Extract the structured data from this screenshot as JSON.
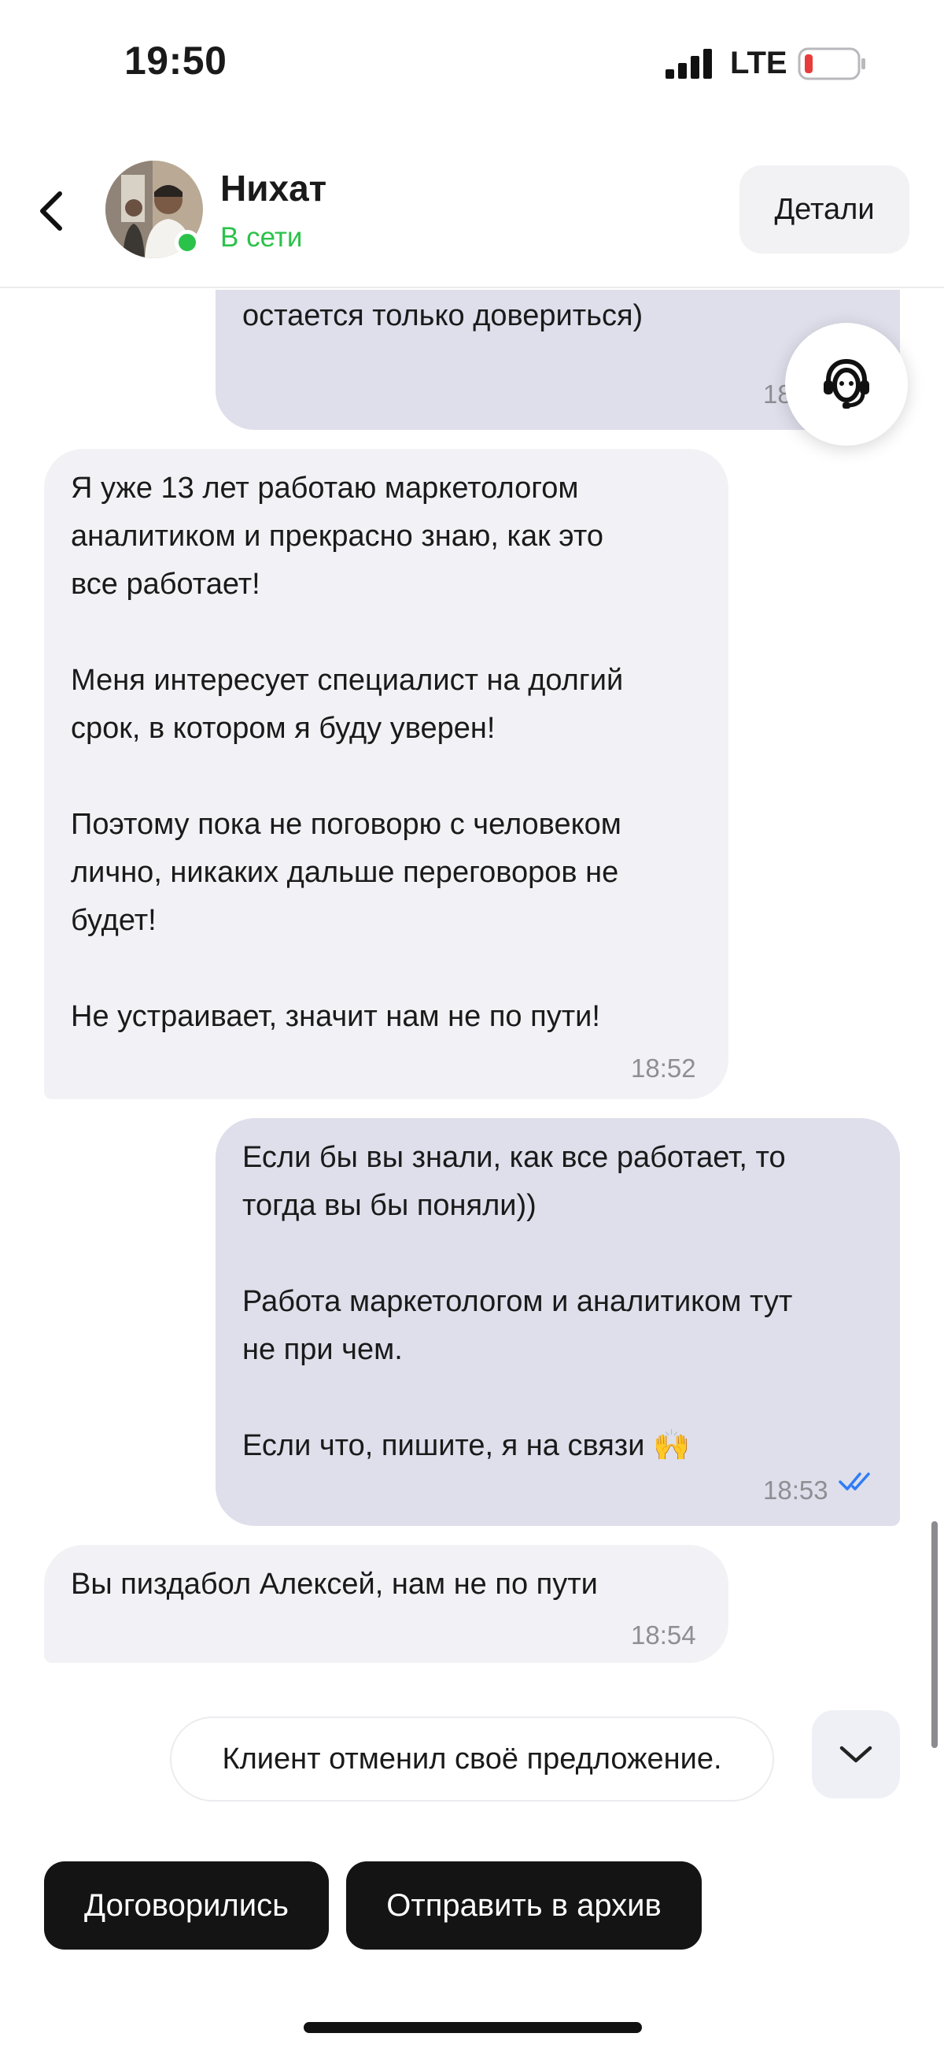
{
  "status_bar": {
    "time": "19:50",
    "network": "LTE",
    "battery_color": "#e83b3b"
  },
  "header": {
    "back_icon": "chevron-left-icon",
    "contact_name": "Нихат",
    "contact_status": "В сети",
    "status_color": "#2bc24a",
    "details_label": "Детали"
  },
  "messages": [
    {
      "direction": "outgoing",
      "text": "приходится работать. Но сейчас вам\nостается только довериться)",
      "time": "18:"
    },
    {
      "direction": "incoming",
      "text": "Я уже 13 лет работаю маркетологом\nаналитиком и прекрасно знаю, как это\nвсе работает!\n\nМеня интересует специалист на долгий\nсрок, в котором я буду уверен!\n\nПоэтому пока не поговорю с человеком\nлично, никаких дальше переговоров не\nбудет!\n\nНе устраивает, значит нам не по пути!",
      "time": "18:52"
    },
    {
      "direction": "outgoing",
      "text": "Если бы вы знали, как все работает, то\nтогда вы бы поняли))\n\nРабота маркетологом и аналитиком тут\nне при чем.\n\nЕсли что, пишите, я на связи 🙌",
      "time": "18:53",
      "read": true
    },
    {
      "direction": "incoming",
      "text": "Вы пиздабол Алексей, нам не по пути",
      "time": "18:54"
    }
  ],
  "system_notice": "Клиент отменил своё предложение.",
  "actions": {
    "agreed_label": "Договорились",
    "archive_label": "Отправить в архив"
  },
  "icons": {
    "support": "support-agent-icon",
    "scroll_down": "chevron-down-icon",
    "read_receipt": "double-check-icon"
  },
  "colors": {
    "incoming_bubble": "#f2f2f6",
    "outgoing_bubble": "#dedfeb",
    "read_check": "#2f7cf6",
    "action_button": "#141414"
  }
}
